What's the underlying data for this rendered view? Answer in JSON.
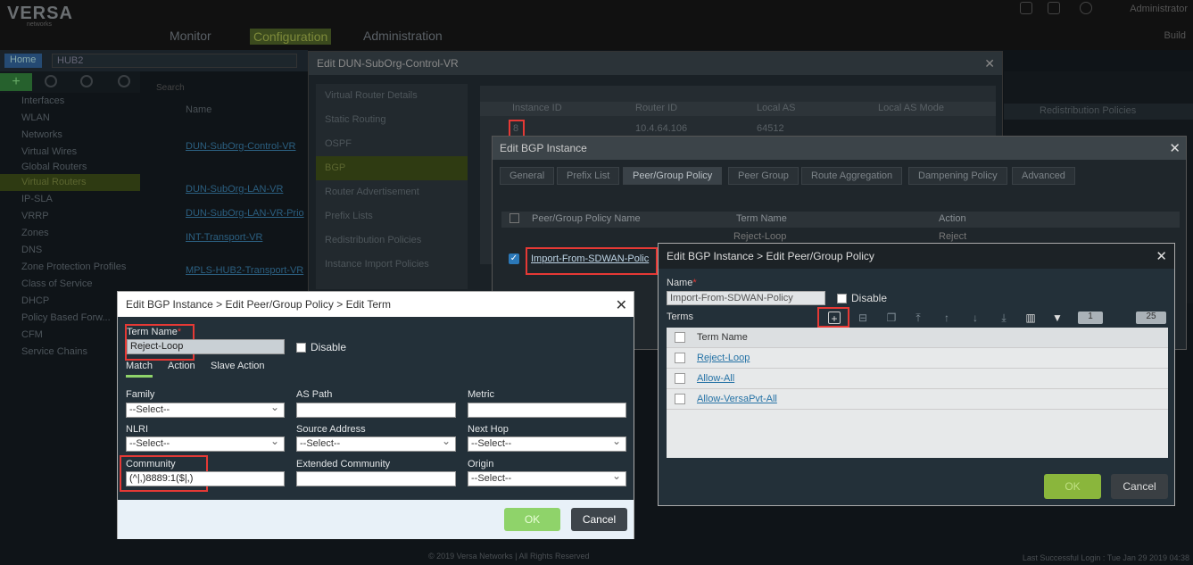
{
  "app": {
    "brand": "VERSA",
    "brand_sub": "networks",
    "user": "Administrator",
    "build": "Build"
  },
  "nav": {
    "monitor": "Monitor",
    "configuration": "Configuration",
    "administration": "Administration"
  },
  "left": {
    "home": "Home",
    "hub": "HUB2",
    "search_placeholder": "Search",
    "name_col": "Name",
    "items": [
      "Interfaces",
      "WLAN",
      "Networks",
      "Virtual Wires",
      "Global Routers",
      "Virtual Routers",
      "IP-SLA",
      "VRRP",
      "Zones",
      "DNS",
      "Zone Protection Profiles",
      "Class of Service",
      "DHCP",
      "Policy Based Forw...",
      "CFM",
      "Service Chains"
    ],
    "vr_links": [
      "DUN-SubOrg-Control-VR",
      "DUN-SubOrg-LAN-VR",
      "DUN-SubOrg-LAN-VR-Prio",
      "INT-Transport-VR",
      "MPLS-HUB2-Transport-VR"
    ]
  },
  "dun_dialog": {
    "title": "Edit DUN-SubOrg-Control-VR",
    "menu": [
      "Virtual Router Details",
      "Static Routing",
      "OSPF",
      "BGP",
      "Router Advertisement",
      "Prefix Lists",
      "Redistribution Policies",
      "Instance Import Policies"
    ],
    "cols": [
      "Instance ID",
      "Router ID",
      "Local AS",
      "Local AS Mode"
    ],
    "row": {
      "id": "8",
      "router_id": "10.4.64.106",
      "local_as": "64512"
    }
  },
  "right_bg": {
    "col": "Redistribution Policies"
  },
  "bgp_dialog": {
    "title": "Edit BGP Instance",
    "tabs": [
      "General",
      "Prefix List",
      "Peer/Group Policy",
      "Peer Group",
      "Route Aggregation",
      "Dampening Policy",
      "Advanced"
    ],
    "cols": [
      "Peer/Group Policy Name",
      "Term Name",
      "Action"
    ],
    "row": {
      "name": "Import-From-SDWAN-Polic",
      "term": "Reject-Loop",
      "action": "Reject"
    }
  },
  "peer_dialog": {
    "title": "Edit BGP Instance > Edit Peer/Group Policy",
    "name_label": "Name",
    "name_value": "Import-From-SDWAN-Policy",
    "disable": "Disable",
    "terms_label": "Terms",
    "col_term": "Term Name",
    "terms": [
      "Reject-Loop",
      "Allow-All",
      "Allow-VersaPvt-All"
    ],
    "page": "1",
    "page_size": "25",
    "ok": "OK",
    "cancel": "Cancel"
  },
  "term_dialog": {
    "title": "Edit BGP Instance > Edit Peer/Group Policy > Edit Term",
    "term_name_label": "Term Name",
    "term_name_value": "Reject-Loop",
    "disable": "Disable",
    "subtabs": [
      "Match",
      "Action",
      "Slave Action"
    ],
    "family_label": "Family",
    "family_value": "--Select--",
    "aspath_label": "AS Path",
    "metric_label": "Metric",
    "nlri_label": "NLRI",
    "nlri_value": "--Select--",
    "src_label": "Source Address",
    "src_value": "--Select--",
    "nexthop_label": "Next Hop",
    "nexthop_value": "--Select--",
    "community_label": "Community",
    "community_value": "(^|,)8889:1($|,)",
    "extcomm_label": "Extended Community",
    "origin_label": "Origin",
    "origin_value": "--Select--",
    "ok": "OK",
    "cancel": "Cancel"
  },
  "footer": {
    "copyright": "© 2019 Versa Networks | All Rights Reserved",
    "last_login": "Last Successful Login : Tue Jan 29 2019 04:38"
  }
}
